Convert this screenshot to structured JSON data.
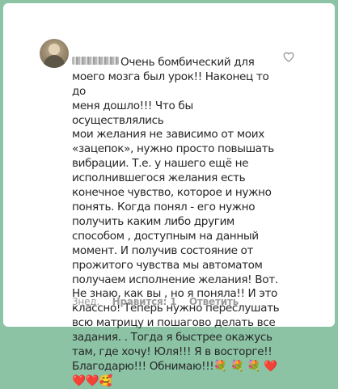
{
  "comment": {
    "text": "Очень бомбический для моего мозга был урок!! Наконец то до меня дошло!!! Что бы осуществлялись мои желания  не зависимо от моих «зацепок», нужно просто повышать вибрации. Т.е. у нашего ещё не исполнившегося желания есть конечное чувство, которое и нужно понять. Когда понял - его нужно получить каким либо другим способом , доступным на данный момент. И получив состояние от прожитого чувства мы автоматом получаем исполнение желания! Вот. Не знаю, как вы , но я поняла!! И это классно! Теперь нужно переслушать всю матрицу и пошагово делать все задания. . Тогда я быстрее окажусь там, где хочу! Юля!!! Я в восторге!! Благодарю!!! Обнимаю!!!💐 💐 💐 ❤️ ❤️❤️🥰",
    "lines": [
      "Очень бомбический для",
      "моего мозга был урок!! Наконец то до",
      "меня дошло!!! Что бы осуществлялись",
      "мои желания  не зависимо от моих",
      "«зацепок», нужно просто повышать",
      "вибрации. Т.е. у нашего ещё не",
      "исполнившегося желания есть",
      "конечное чувство, которое и нужно",
      "понять. Когда понял - его нужно",
      "получить каким либо другим",
      "способом , доступным на данный",
      "момент. И получив состояние от",
      "прожитого чувства мы автоматом",
      "получаем исполнение желания! Вот.",
      "Не знаю, как вы , но я поняла!! И это",
      "классно! Теперь нужно переслушать",
      "всю матрицу и пошагово делать все",
      "задания. . Тогда я быстрее окажусь",
      "там, где хочу! Юля!!! Я в восторге!!",
      "Благодарю!!! Обнимаю!!!💐 💐 💐 ❤️",
      "❤️❤️🥰"
    ]
  },
  "meta": {
    "time": "3нед.",
    "likes": "Нравится: 1",
    "reply": "Ответить"
  },
  "icons": {
    "like": "heart-outline-icon",
    "avatar": "user-avatar"
  },
  "colors": {
    "background": "#8cc3a5",
    "card": "#ffffff",
    "text": "#262626",
    "meta": "#9a9a9a"
  }
}
